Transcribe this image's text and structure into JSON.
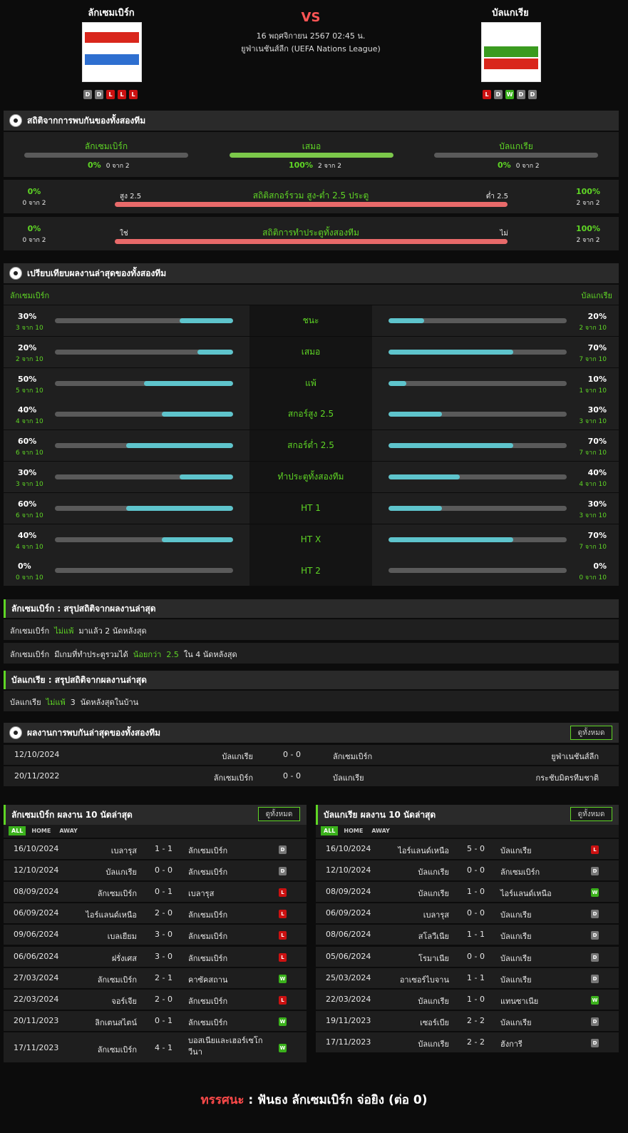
{
  "header": {
    "home": "ลักเซมเบิร์ก",
    "away": "บัลแกเรีย",
    "vs": "VS",
    "datetime": "16 พฤศจิกายน 2567 02:45 น.",
    "league": "ยูฟ่าเนชันส์ลีก (UEFA Nations League)",
    "home_form": [
      "D",
      "D",
      "L",
      "L",
      "L"
    ],
    "away_form": [
      "L",
      "D",
      "W",
      "D",
      "D"
    ]
  },
  "h2h": {
    "title": "สถิติจากการพบกันของทั้งสองทีม",
    "cols": [
      {
        "label": "ลักเซมเบิร์ก",
        "pct": "0%",
        "sub": "0 จาก 2",
        "value": 0
      },
      {
        "label": "เสมอ",
        "pct": "100%",
        "sub": "2 จาก 2",
        "value": 100
      },
      {
        "label": "บัลแกเรีย",
        "pct": "0%",
        "sub": "0 จาก 2",
        "value": 0
      }
    ],
    "ou": {
      "left_pct": "0%",
      "left_sub": "0 จาก 2",
      "left_lbl": "สูง 2.5",
      "title": "สถิติสกอร์รวม สูง-ต่ำ 2.5 ประตู",
      "right_lbl": "ต่ำ 2.5",
      "right_pct": "100%",
      "right_sub": "2 จาก 2"
    },
    "btts": {
      "left_pct": "0%",
      "left_sub": "0 จาก 2",
      "left_lbl": "ใช่",
      "title": "สถิติการทำประตูทั้งสองทีม",
      "right_lbl": "ไม่",
      "right_pct": "100%",
      "right_sub": "2 จาก 2"
    }
  },
  "compare": {
    "title": "เปรียบเทียบผลงานล่าสุดของทั้งสองทีม",
    "home": "ลักเซมเบิร์ก",
    "away": "บัลแกเรีย",
    "rows": [
      {
        "label": "ชนะ",
        "l_pct": "30%",
        "l_sub": "3 จาก 10",
        "l": 30,
        "r_pct": "20%",
        "r_sub": "2 จาก 10",
        "r": 20
      },
      {
        "label": "เสมอ",
        "l_pct": "20%",
        "l_sub": "2 จาก 10",
        "l": 20,
        "r_pct": "70%",
        "r_sub": "7 จาก 10",
        "r": 70
      },
      {
        "label": "แพ้",
        "l_pct": "50%",
        "l_sub": "5 จาก 10",
        "l": 50,
        "r_pct": "10%",
        "r_sub": "1 จาก 10",
        "r": 10
      },
      {
        "label": "สกอร์สูง 2.5",
        "l_pct": "40%",
        "l_sub": "4 จาก 10",
        "l": 40,
        "r_pct": "30%",
        "r_sub": "3 จาก 10",
        "r": 30
      },
      {
        "label": "สกอร์ต่ำ 2.5",
        "l_pct": "60%",
        "l_sub": "6 จาก 10",
        "l": 60,
        "r_pct": "70%",
        "r_sub": "7 จาก 10",
        "r": 70
      },
      {
        "label": "ทำประตูทั้งสองทีม",
        "l_pct": "30%",
        "l_sub": "3 จาก 10",
        "l": 30,
        "r_pct": "40%",
        "r_sub": "4 จาก 10",
        "r": 40
      },
      {
        "label": "HT 1",
        "l_pct": "60%",
        "l_sub": "6 จาก 10",
        "l": 60,
        "r_pct": "30%",
        "r_sub": "3 จาก 10",
        "r": 30
      },
      {
        "label": "HT X",
        "l_pct": "40%",
        "l_sub": "4 จาก 10",
        "l": 40,
        "r_pct": "70%",
        "r_sub": "7 จาก 10",
        "r": 70
      },
      {
        "label": "HT 2",
        "l_pct": "0%",
        "l_sub": "0 จาก 10",
        "l": 0,
        "r_pct": "0%",
        "r_sub": "0 จาก 10",
        "r": 0
      }
    ]
  },
  "home_summary": {
    "title": "ลักเซมเบิร์ก : สรุปสถิติจากผลงานล่าสุด",
    "line1": {
      "a": "ลักเซมเบิร์ก",
      "b": "ไม่แพ้",
      "c": "มาแล้ว 2 นัดหลังสุด"
    },
    "line2": {
      "a": "ลักเซมเบิร์ก",
      "b": "มีเกมที่ทำประตูรวมได้",
      "c": "น้อยกว่า",
      "d": "2.5",
      "e": "ใน 4 นัดหลังสุด"
    }
  },
  "away_summary": {
    "title": "บัลแกเรีย : สรุปสถิติจากผลงานล่าสุด",
    "line1": {
      "a": "บัลแกเรีย",
      "b": "ไม่แพ้",
      "c": "3",
      "d": "นัดหลังสุดในบ้าน"
    }
  },
  "h2h_results": {
    "title": "ผลงานการพบกันล่าสุดของทั้งสองทีม",
    "view_all": "ดูทั้งหมด",
    "rows": [
      {
        "date": "12/10/2024",
        "home": "บัลแกเรีย",
        "score": "0 - 0",
        "away": "ลักเซมเบิร์ก",
        "comp": "ยูฟ่าเนชันส์ลีก"
      },
      {
        "date": "20/11/2022",
        "home": "ลักเซมเบิร์ก",
        "score": "0 - 0",
        "away": "บัลแกเรีย",
        "comp": "กระชับมิตรทีมชาติ"
      }
    ]
  },
  "home_last10": {
    "title": "ลักเซมเบิร์ก ผลงาน 10 นัดล่าสุด",
    "view_all": "ดูทั้งหมด",
    "tabs": [
      "ALL",
      "HOME",
      "AWAY"
    ],
    "rows": [
      {
        "date": "16/10/2024",
        "home": "เบลารุส",
        "score": "1 - 1",
        "away": "ลักเซมเบิร์ก",
        "res": "D"
      },
      {
        "date": "12/10/2024",
        "home": "บัลแกเรีย",
        "score": "0 - 0",
        "away": "ลักเซมเบิร์ก",
        "res": "D"
      },
      {
        "date": "08/09/2024",
        "home": "ลักเซมเบิร์ก",
        "score": "0 - 1",
        "away": "เบลารุส",
        "res": "L"
      },
      {
        "date": "06/09/2024",
        "home": "ไอร์แลนด์เหนือ",
        "score": "2 - 0",
        "away": "ลักเซมเบิร์ก",
        "res": "L"
      },
      {
        "date": "09/06/2024",
        "home": "เบลเยียม",
        "score": "3 - 0",
        "away": "ลักเซมเบิร์ก",
        "res": "L"
      },
      {
        "date": "06/06/2024",
        "home": "ฝรั่งเศส",
        "score": "3 - 0",
        "away": "ลักเซมเบิร์ก",
        "res": "L"
      },
      {
        "date": "27/03/2024",
        "home": "ลักเซมเบิร์ก",
        "score": "2 - 1",
        "away": "คาซัคสถาน",
        "res": "W"
      },
      {
        "date": "22/03/2024",
        "home": "จอร์เจีย",
        "score": "2 - 0",
        "away": "ลักเซมเบิร์ก",
        "res": "L"
      },
      {
        "date": "20/11/2023",
        "home": "ลิกเตนสไตน์",
        "score": "0 - 1",
        "away": "ลักเซมเบิร์ก",
        "res": "W"
      },
      {
        "date": "17/11/2023",
        "home": "ลักเซมเบิร์ก",
        "score": "4 - 1",
        "away": "บอสเนียและเฮอร์เซโกวีนา",
        "res": "W"
      }
    ]
  },
  "away_last10": {
    "title": "บัลแกเรีย ผลงาน 10 นัดล่าสุด",
    "view_all": "ดูทั้งหมด",
    "tabs": [
      "ALL",
      "HOME",
      "AWAY"
    ],
    "rows": [
      {
        "date": "16/10/2024",
        "home": "ไอร์แลนด์เหนือ",
        "score": "5 - 0",
        "away": "บัลแกเรีย",
        "res": "L"
      },
      {
        "date": "12/10/2024",
        "home": "บัลแกเรีย",
        "score": "0 - 0",
        "away": "ลักเซมเบิร์ก",
        "res": "D"
      },
      {
        "date": "08/09/2024",
        "home": "บัลแกเรีย",
        "score": "1 - 0",
        "away": "ไอร์แลนด์เหนือ",
        "res": "W"
      },
      {
        "date": "06/09/2024",
        "home": "เบลารุส",
        "score": "0 - 0",
        "away": "บัลแกเรีย",
        "res": "D"
      },
      {
        "date": "08/06/2024",
        "home": "สโลวีเนีย",
        "score": "1 - 1",
        "away": "บัลแกเรีย",
        "res": "D"
      },
      {
        "date": "05/06/2024",
        "home": "โรมาเนีย",
        "score": "0 - 0",
        "away": "บัลแกเรีย",
        "res": "D"
      },
      {
        "date": "25/03/2024",
        "home": "อาเซอร์ไบจาน",
        "score": "1 - 1",
        "away": "บัลแกเรีย",
        "res": "D"
      },
      {
        "date": "22/03/2024",
        "home": "บัลแกเรีย",
        "score": "1 - 0",
        "away": "แทนซาเนีย",
        "res": "W"
      },
      {
        "date": "19/11/2023",
        "home": "เซอร์เบีย",
        "score": "2 - 2",
        "away": "บัลแกเรีย",
        "res": "D"
      },
      {
        "date": "17/11/2023",
        "home": "บัลแกเรีย",
        "score": "2 - 2",
        "away": "ฮังการี",
        "res": "D"
      }
    ]
  },
  "prediction": {
    "label": "ทรรศนะ",
    "colon": ":",
    "text": "ฟันธง ลักเซมเบิร์ก จ่อยิง (ต่อ 0)"
  },
  "colors": {
    "green": "#5fd625",
    "cyan": "#5ec4cc",
    "red": "#e86a6a",
    "panel": "#1f1f1f"
  }
}
